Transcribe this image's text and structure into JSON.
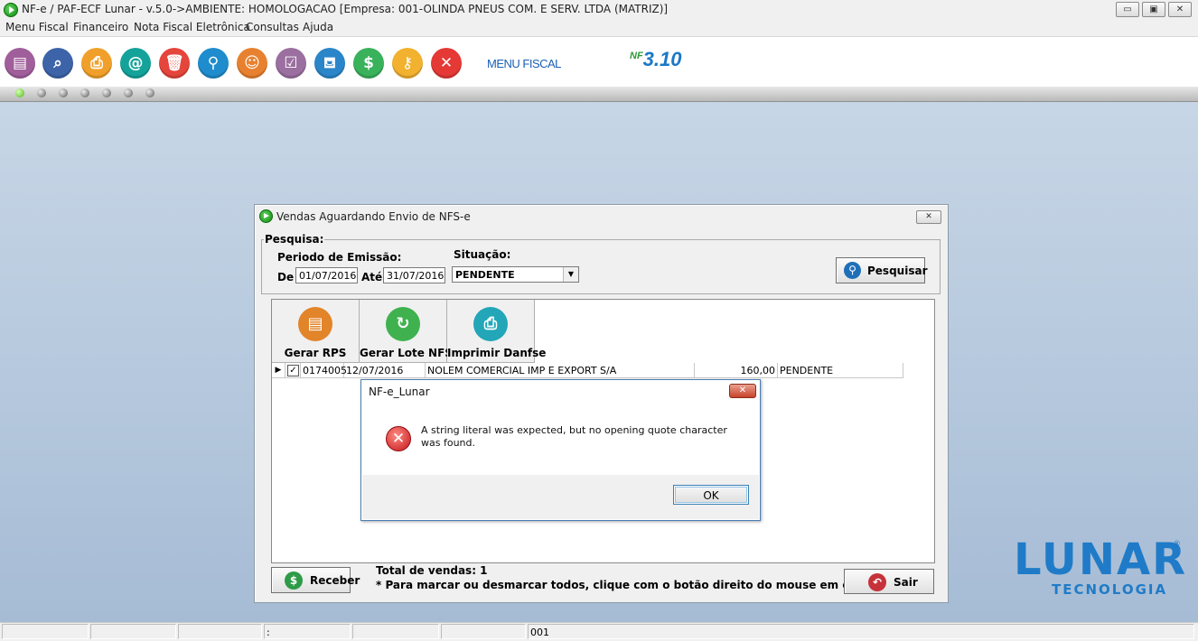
{
  "app": {
    "title": "NF-e / PAF-ECF Lunar - v.5.0->AMBIENTE: HOMOLOGACAO [Empresa: 001-OLINDA PNEUS COM. E SERV. LTDA (MATRIZ)]",
    "window_buttons": {
      "minimize": "▭",
      "restore": "▣",
      "close": "✕"
    }
  },
  "menu": [
    "Menu Fiscal",
    "Financeiro",
    "Nota Fiscal Eletrônica",
    "Consultas",
    "Ajuda"
  ],
  "toolbar": {
    "buttons": [
      {
        "icon": "nfe-document-icon",
        "color": "#a05f9a",
        "glyph": "▤"
      },
      {
        "icon": "search-document-icon",
        "color": "#3d63a8",
        "glyph": "⌕"
      },
      {
        "icon": "printer-icon",
        "color": "#f0a02a",
        "glyph": "⎙"
      },
      {
        "icon": "email-icon",
        "color": "#14a39a",
        "glyph": "@"
      },
      {
        "icon": "trash-icon",
        "color": "#e5453b",
        "glyph": "🗑"
      },
      {
        "icon": "magnifier-icon",
        "color": "#1f8ccd",
        "glyph": "⚲"
      },
      {
        "icon": "users-icon",
        "color": "#e8812f",
        "glyph": "☺"
      },
      {
        "icon": "checklist-icon",
        "color": "#9b6fa0",
        "glyph": "☑"
      },
      {
        "icon": "basket-icon",
        "color": "#2a86c9",
        "glyph": "⛾"
      },
      {
        "icon": "coins-icon",
        "color": "#39b25b",
        "glyph": "$"
      },
      {
        "icon": "key-icon",
        "color": "#f2b12e",
        "glyph": "⚷"
      },
      {
        "icon": "exit-icon",
        "color": "#e53935",
        "glyph": "✕"
      }
    ],
    "menu_fiscal_label": "MENU FISCAL",
    "nfe_version": "3.10",
    "nfe_badge": "NF"
  },
  "dots": {
    "count": 7,
    "active_index": 0
  },
  "window": {
    "title": "Vendas Aguardando Envio de NFS-e",
    "close_glyph": "✕",
    "search_group": {
      "legend": "Pesquisa:",
      "periodo_label": "Periodo de Emissão:",
      "de_label": "De",
      "de_value": "01/07/2016",
      "ate_label": "Até",
      "ate_value": "31/07/2016",
      "situacao_label": "Situação:",
      "situacao_value": "PENDENTE",
      "search_button": "Pesquisar"
    },
    "action_buttons": [
      {
        "label": "Gerar RPS",
        "icon": "rps-document-icon",
        "color": "#e2842a",
        "glyph": "▤"
      },
      {
        "label": "Gerar Lote NFSe",
        "icon": "refresh-icon",
        "color": "#3fb24f",
        "glyph": "↻"
      },
      {
        "label": "Imprimir Danfse",
        "icon": "printer-icon",
        "color": "#22a6b8",
        "glyph": "⎙"
      }
    ],
    "grid": {
      "rows": [
        {
          "selected": true,
          "codigo": "0174005",
          "data": "12/07/2016",
          "cliente": "NOLEM COMERCIAL IMP E EXPORT S/A",
          "valor": "160,00",
          "situacao": "PENDENTE"
        }
      ]
    },
    "footer": {
      "receber_button": "Receber",
      "total_text": "Total de vendas: 1",
      "hint_text": "* Para marcar ou desmarcar todos, clique com o botão direito do mouse em cima do Grid.",
      "sair_button": "Sair"
    }
  },
  "dialog": {
    "title": "NF-e_Lunar",
    "close_glyph": "✕",
    "message": "A string literal was expected, but no opening quote character was found.",
    "ok_button": "OK"
  },
  "logo": {
    "main": "LUNAR",
    "sub": "TECNOLOGIA",
    "reg": "®"
  },
  "statusbar": {
    "panels": [
      "",
      "",
      "",
      ":",
      "",
      "",
      "001"
    ]
  }
}
